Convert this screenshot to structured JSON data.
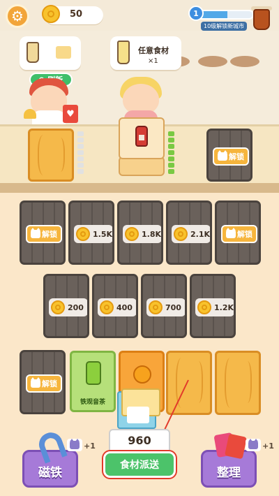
{
  "topbar": {
    "coins": "50",
    "level": "1",
    "level_text": "10级解锁新城市",
    "level_progress": 0.55
  },
  "shop": {
    "refresh_label": "刷新",
    "request_title": "任意食材",
    "request_count": "×1"
  },
  "board": {
    "unlock_label": "解锁",
    "row1_prices": [
      "1.5K",
      "1.8K",
      "2.1K"
    ],
    "row2_prices": [
      "200",
      "400",
      "700",
      "1.2K"
    ],
    "green_card_label": "铁观音茶"
  },
  "controls": {
    "magnet_label": "磁铁",
    "magnet_plus": "+1",
    "sort_label": "整理",
    "sort_plus": "+1",
    "dispatch_label": "食材派送",
    "dispatch_count": "960"
  },
  "colors": {
    "accent_orange": "#f6b53d",
    "accent_green": "#4cc36a",
    "accent_purple": "#a67ad8",
    "locked_tile": "#6a615b"
  }
}
